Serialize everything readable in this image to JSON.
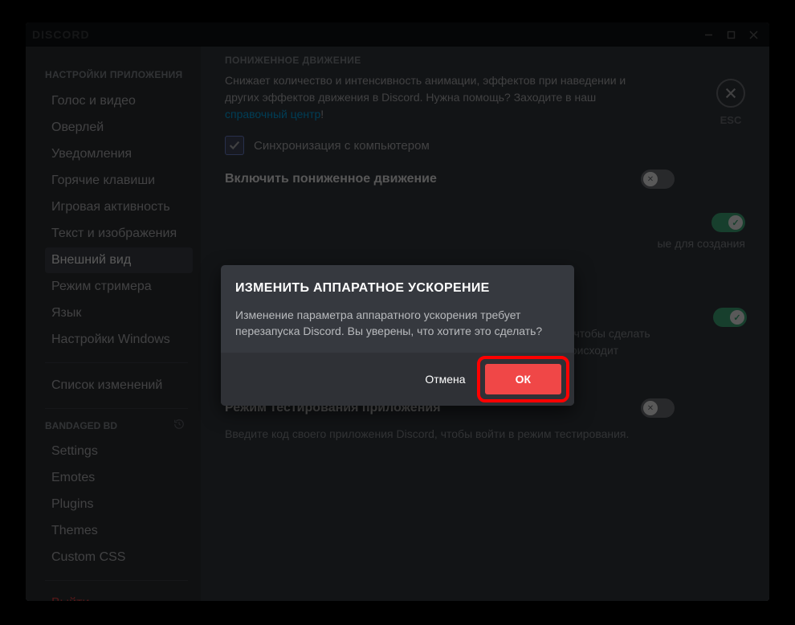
{
  "titlebar": {
    "wordmark": "DISCORD"
  },
  "sidebar": {
    "header1": "НАСТРОЙКИ ПРИЛОЖЕНИЯ",
    "items": [
      "Голос и видео",
      "Оверлей",
      "Уведомления",
      "Горячие клавиши",
      "Игровая активность",
      "Текст и изображения",
      "Внешний вид",
      "Режим стримера",
      "Язык",
      "Настройки Windows"
    ],
    "sep1_item": "Список изменений",
    "bandaged_label": "BANDAGED BD",
    "bd_items": [
      "Settings",
      "Emotes",
      "Plugins",
      "Themes",
      "Custom CSS"
    ],
    "logout": "Выйти"
  },
  "esc_label": "ESC",
  "content": {
    "motion_header": "ПОНИЖЕННОЕ ДВИЖЕНИЕ",
    "motion_desc_prefix": "Снижает количество и интенсивность анимации, эффектов при наведении и других эффектов движения в Discord. Нужна помощь? Заходите в наш ",
    "motion_desc_link": "справочный центр",
    "motion_desc_suffix": "!",
    "sync_label": "Синхронизация с компьютером",
    "motion_toggle_title": "Включить пониженное движение",
    "dev_hint_tail": "ые для создания",
    "hw_accel_desc": "Включение аппаратного ускорения, которое использует ваш GPU, чтобы сделать работу Discord более плавной. Отключите этот параметр, если происходит падение FPS.",
    "test_mode_title": "Режим тестирования приложения",
    "test_mode_desc": "Введите код своего приложения Discord, чтобы войти в режим тестирования."
  },
  "modal": {
    "title": "ИЗМЕНИТЬ АППАРАТНОЕ УСКОРЕНИЕ",
    "text": "Изменение параметра аппаратного ускорения требует перезапуска Discord. Вы уверены, что хотите это сделать?",
    "cancel": "Отмена",
    "ok": "ОК"
  }
}
